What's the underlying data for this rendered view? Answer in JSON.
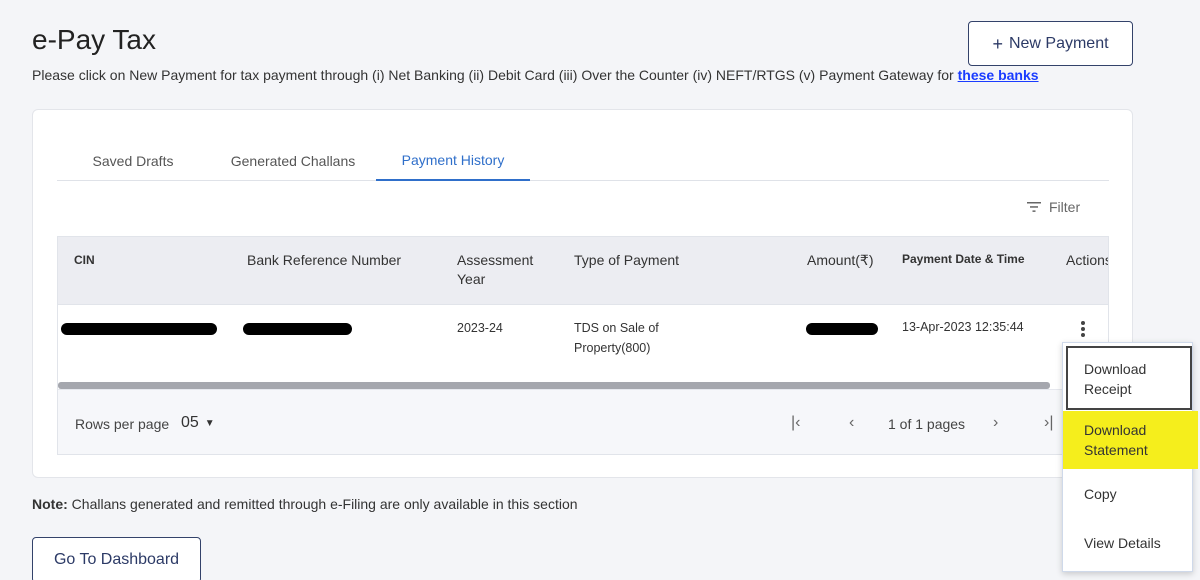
{
  "page": {
    "title": "e-Pay Tax",
    "subtitle": "Please click on New Payment for tax payment through (i) Net Banking (ii) Debit Card (iii) Over the Counter (iv) NEFT/RTGS (v) Payment Gateway for ",
    "subtitle_link": "these banks"
  },
  "header": {
    "new_payment_icon": "+",
    "new_payment_label": "New Payment"
  },
  "tabs": [
    {
      "label": "Saved Drafts",
      "active": false
    },
    {
      "label": "Generated Challans",
      "active": false
    },
    {
      "label": "Payment History",
      "active": true
    }
  ],
  "filter": {
    "icon": "filter-icon",
    "label": "Filter"
  },
  "table": {
    "columns": [
      "CIN",
      "Bank Reference Number",
      "Assessment Year",
      "Type of Payment",
      "Amount(₹)",
      "Payment Date & Time",
      "Actions"
    ],
    "rows": [
      {
        "cin": "",
        "bank_ref": "",
        "assessment_year": "2023-24",
        "type_of_payment": "TDS on Sale of Property(800)",
        "amount": "",
        "payment_datetime": "13-Apr-2023 12:35:44",
        "actions_icon": "more-vertical-icon"
      }
    ]
  },
  "pagination": {
    "rows_per_page_label": "Rows per page",
    "rows_per_page_value": "05",
    "page_status": "1 of 1 pages"
  },
  "note": {
    "label": "Note:",
    "text": "Challans generated and remitted through e-Filing are only available in this section"
  },
  "footer": {
    "dashboard_label": "Go To Dashboard"
  },
  "action_menu": {
    "items": [
      "Download Receipt",
      "Download Statement",
      "Copy",
      "View Details"
    ]
  },
  "colors": {
    "accent": "#2f6fca",
    "button_border": "#33426a",
    "highlight": "#f5ee1c",
    "link": "#1a3cff"
  }
}
